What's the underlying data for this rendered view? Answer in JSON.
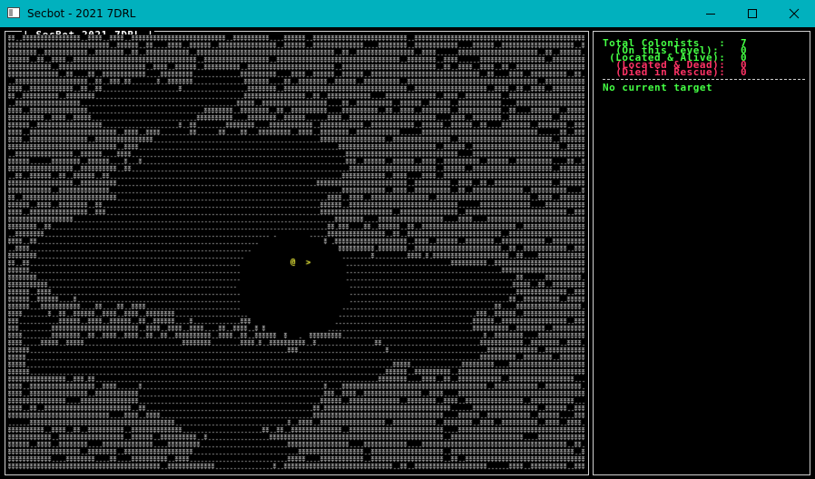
{
  "window": {
    "title": "Secbot - 2021 7DRL",
    "minimize_glyph": "minimize-icon",
    "maximize_glyph": "maximize-icon",
    "close_glyph": "close-icon"
  },
  "map_panel": {
    "title": "| SecBot 2021 7DRL |"
  },
  "player": {
    "glyph": "@",
    "color": "#ffff40"
  },
  "stairs": {
    "glyph": ">",
    "color": "#ffff40"
  },
  "colors": {
    "titlebar": "#01b1be",
    "wall": "#a8a8a8",
    "floor": "#8a8a8a",
    "border": "#d0d0d0",
    "green": "#44ff44",
    "red": "#ff3366"
  },
  "sidebar": {
    "stats": [
      {
        "label": "Total Colonists   :",
        "value": "7",
        "color": "#44ff44"
      },
      {
        "label": "  (On this level):",
        "value": "0",
        "color": "#44ff44"
      },
      {
        "label": " (Located & Alive):",
        "value": "0",
        "color": "#44ff44"
      },
      {
        "label": "  (Located & Dead):",
        "value": "0",
        "color": "#ff3366"
      },
      {
        "label": "  (Died in Rescue):",
        "value": "0",
        "color": "#ff3366"
      }
    ],
    "target": "No current target"
  }
}
